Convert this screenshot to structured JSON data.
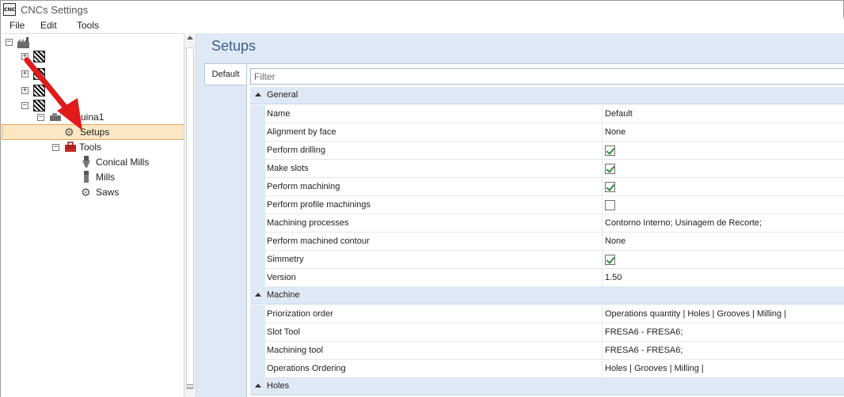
{
  "window": {
    "title": "CNCs Settings",
    "icon": "cnc-app-icon",
    "icon_text_top": "CNC",
    "icon_text_bottom": ""
  },
  "menu": {
    "file": "File",
    "edit": "Edit",
    "tools": "Tools"
  },
  "tree": {
    "machine_name": "uina1",
    "setups": "Setups",
    "tools": "Tools",
    "conical_mills": "Conical Mills",
    "mills": "Mills",
    "saws": "Saws"
  },
  "content": {
    "title": "Setups",
    "tab_default": "Default",
    "filter_placeholder": "Filter"
  },
  "groups": {
    "general": "General",
    "machine": "Machine",
    "holes": "Holes"
  },
  "general_props": [
    {
      "name": "Name",
      "value": "Default"
    },
    {
      "name": "Alignment by face",
      "value": "None"
    },
    {
      "name": "Perform drilling",
      "checked": true
    },
    {
      "name": "Make slots",
      "checked": true
    },
    {
      "name": "Perform machining",
      "checked": true
    },
    {
      "name": "Perform profile machinings",
      "checked": false
    },
    {
      "name": "Machining processes",
      "value": "Contorno Interno; Usinagem de Recorte;"
    },
    {
      "name": "Perform machined contour",
      "value": "None"
    },
    {
      "name": "Simmetry",
      "checked": true
    },
    {
      "name": "Version",
      "value": "1.50"
    }
  ],
  "machine_props": [
    {
      "name": "Priorization order",
      "value": "Operations quantity | Holes | Grooves | Milling |"
    },
    {
      "name": "Slot Tool",
      "value": "FRESA6 - FRESA6;"
    },
    {
      "name": "Machining tool",
      "value": "FRESA6 - FRESA6;"
    },
    {
      "name": "Operations Ordering",
      "value": "Holes | Grooves | Milling |"
    }
  ],
  "colors": {
    "accent": "#3f5f86",
    "selection": "#fbe7c4",
    "annotation_arrow": "#e11a1a",
    "check": "#2f8a38"
  }
}
